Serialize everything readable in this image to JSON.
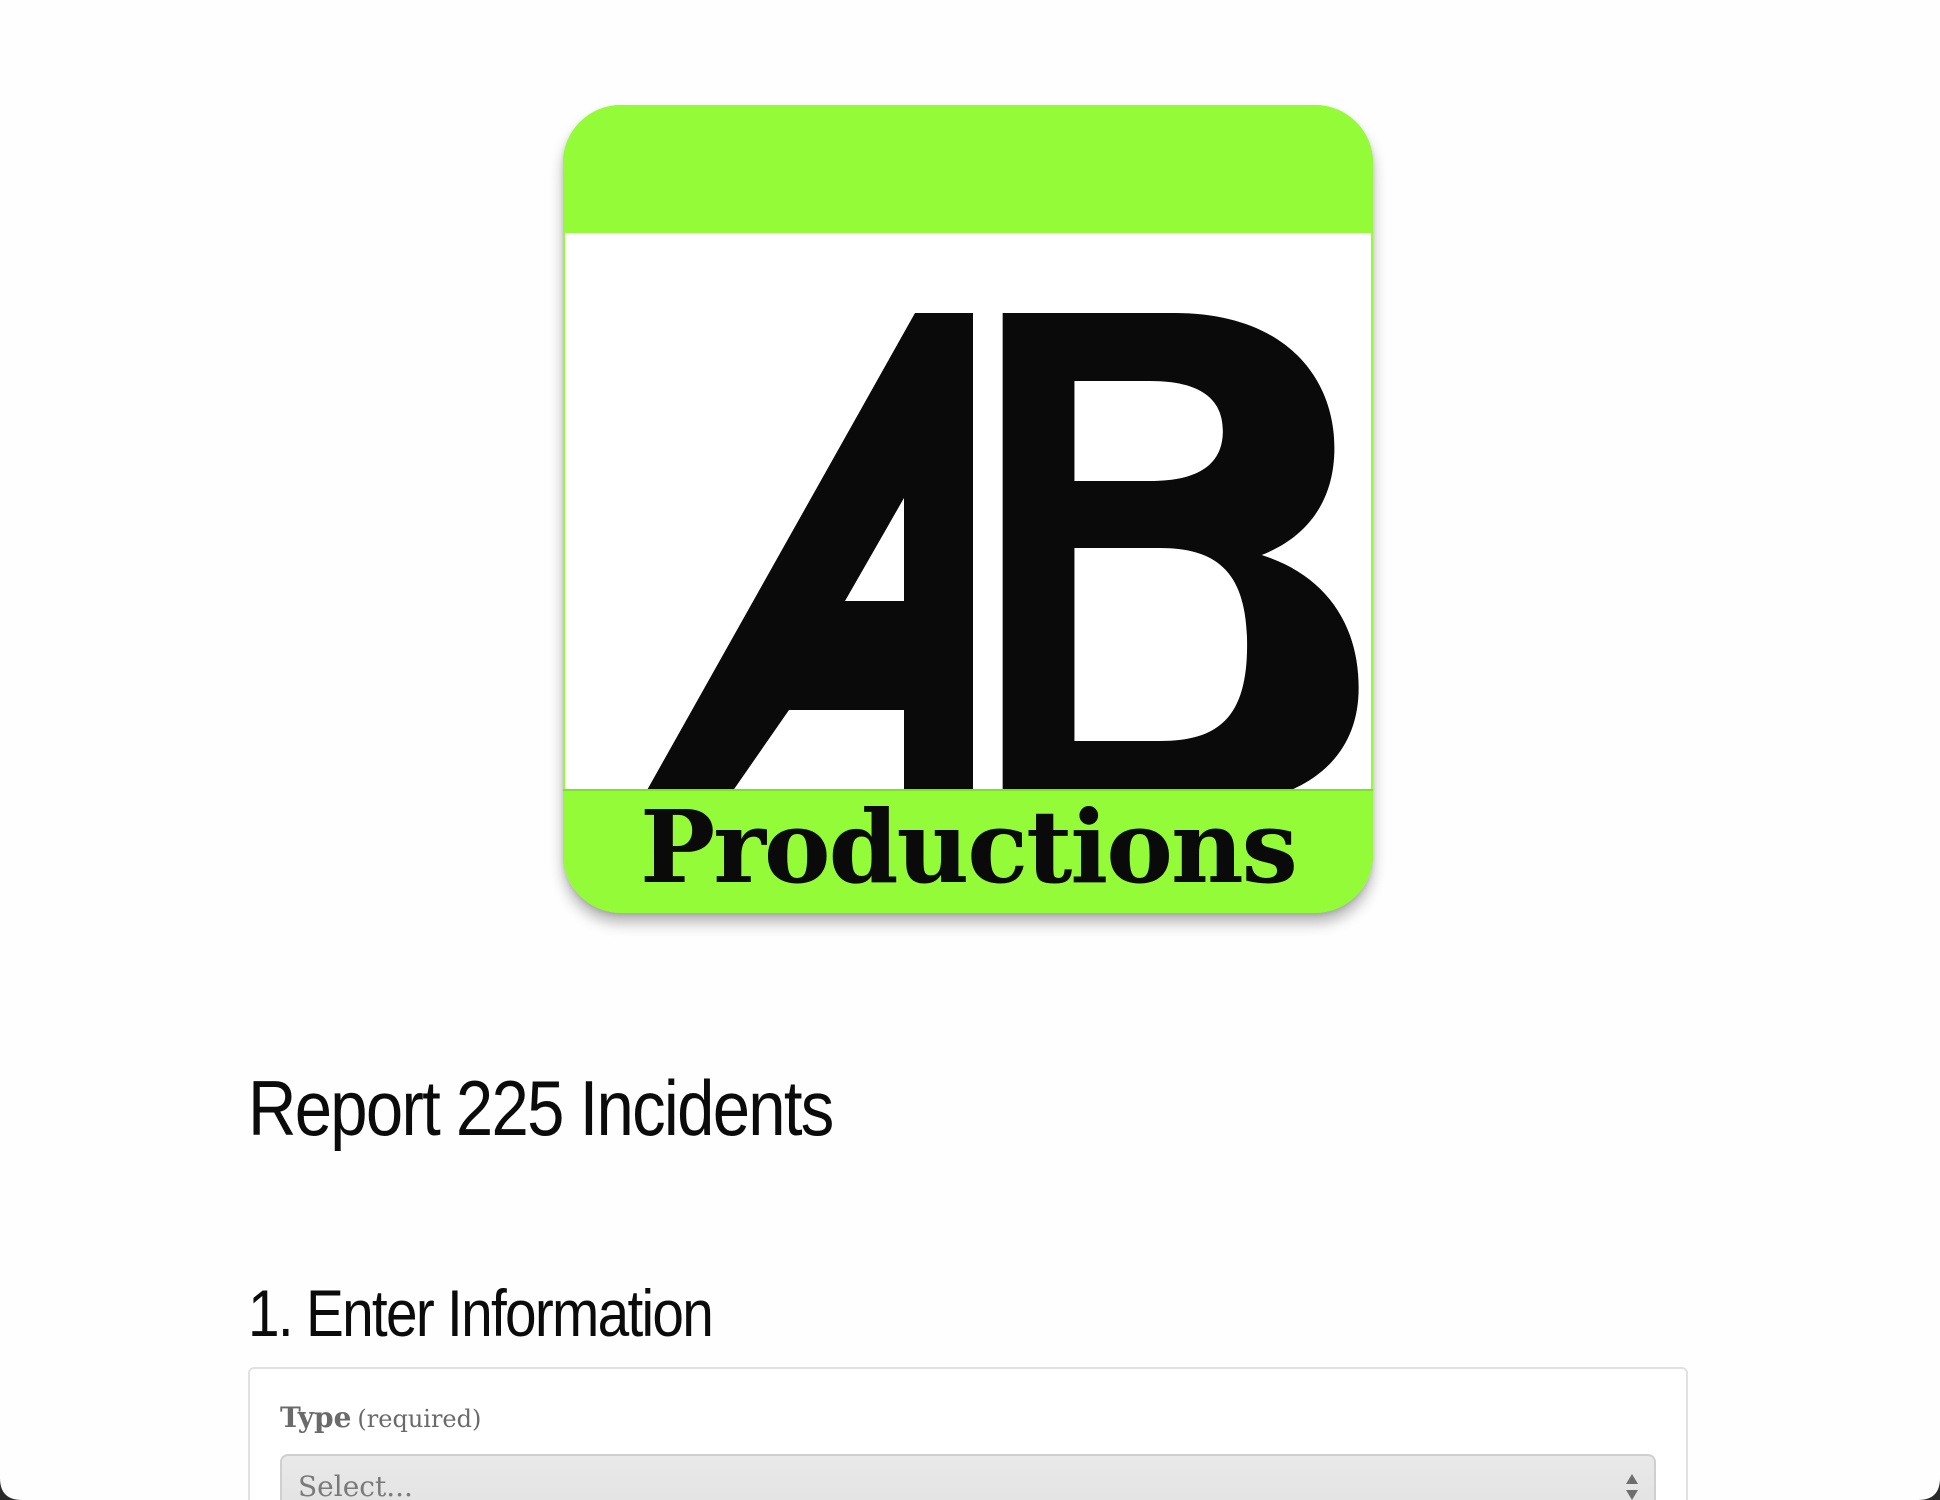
{
  "logo": {
    "letters": "AB",
    "tagline": "Productions",
    "colors": {
      "accent": "#93fb38",
      "ink": "#0a0a0a",
      "panel": "#ffffff"
    }
  },
  "page": {
    "title": "Report 225 Incidents"
  },
  "section": {
    "title": "1. Enter Information"
  },
  "form": {
    "type_field": {
      "label": "Type",
      "required_note": "(required)",
      "value": "Select...",
      "icon": "select-arrows-icon"
    }
  }
}
